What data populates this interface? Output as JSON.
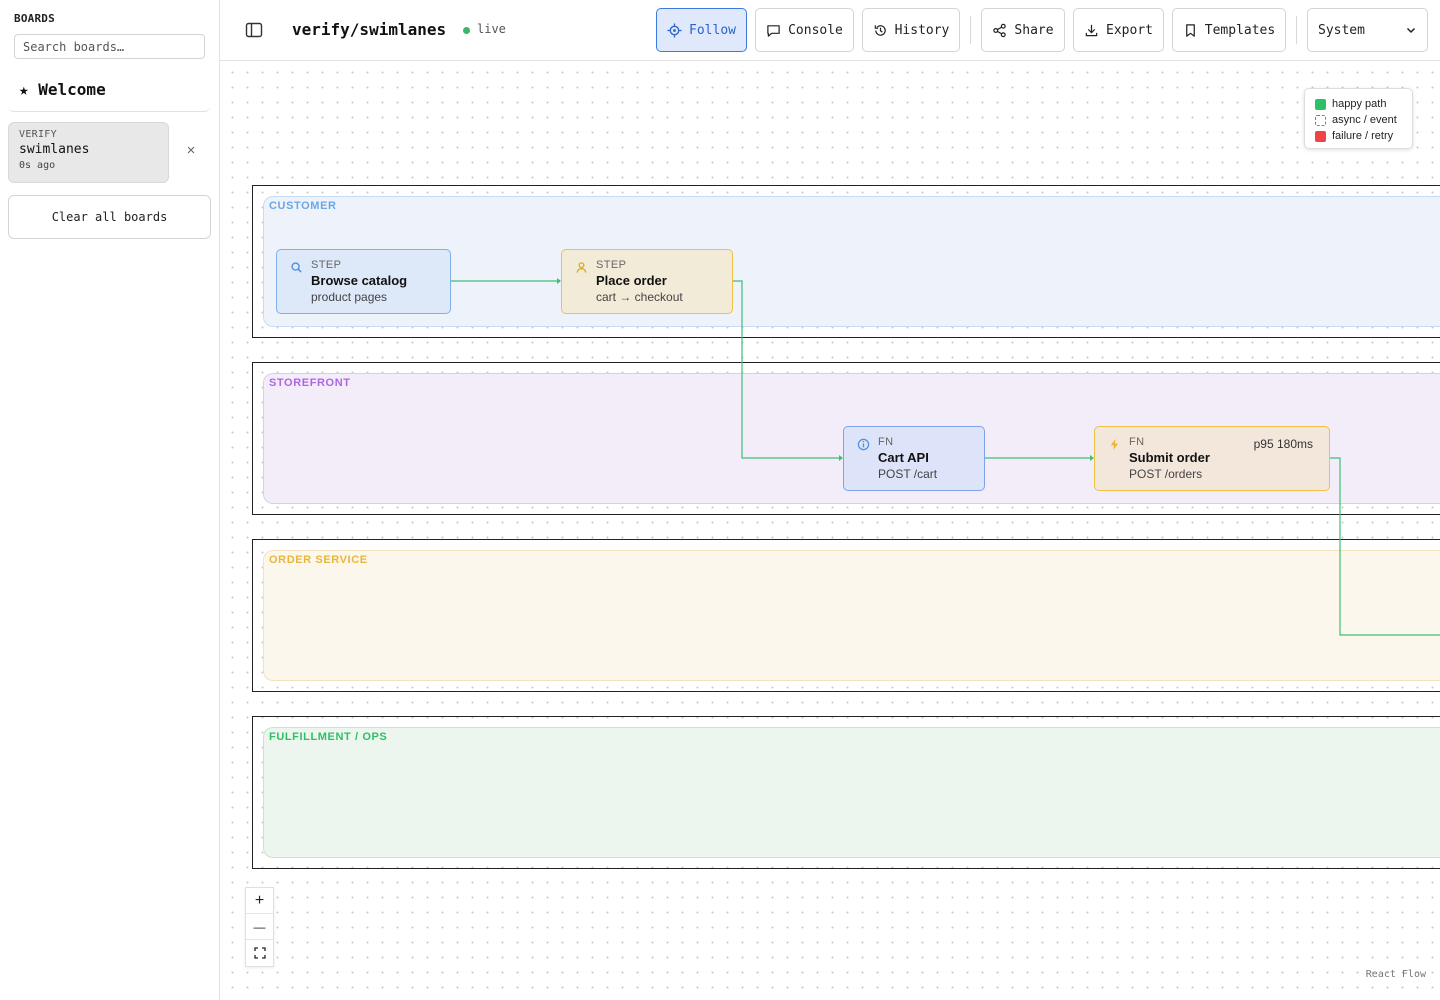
{
  "sidebar": {
    "title": "BOARDS",
    "search_placeholder": "Search boards…",
    "welcome_label": "★ Welcome",
    "active_board": {
      "group": "VERIFY",
      "name": "swimlanes",
      "time": "0s ago"
    },
    "close_glyph": "×",
    "clear_label": "Clear all boards"
  },
  "header": {
    "title": "verify/swimlanes",
    "status": "live",
    "status_color": "#3bb56c",
    "buttons": {
      "follow": "Follow",
      "console": "Console",
      "history": "History",
      "share": "Share",
      "export": "Export",
      "templates": "Templates"
    },
    "theme_value": "System"
  },
  "legend": {
    "items": [
      {
        "label": "happy path",
        "color": "#2fbf64",
        "style": "solid"
      },
      {
        "label": "async / event",
        "color": "#a855f7",
        "style": "dashed"
      },
      {
        "label": "failure / retry",
        "color": "#ef4444",
        "style": "solid"
      }
    ]
  },
  "lanes": [
    {
      "label": "CUSTOMER",
      "color": "#6aa6e8",
      "fill": "#eef3fb",
      "border": "#c5dbf5"
    },
    {
      "label": "STOREFRONT",
      "color": "#b066e0",
      "fill": "#f2edf9",
      "border": "#dccbf0"
    },
    {
      "label": "ORDER SERVICE",
      "color": "#e9b63a",
      "fill": "#fcf7ec",
      "border": "#f3e3b8"
    },
    {
      "label": "FULFILLMENT / OPS",
      "color": "#2fbf64",
      "fill": "#ecf6ef",
      "border": "#c3e6cf"
    }
  ],
  "nodes": {
    "browse": {
      "type": "STEP",
      "title": "Browse catalog",
      "subtitle": "product pages",
      "icon": "search-icon"
    },
    "place": {
      "type": "STEP",
      "title": "Place order",
      "subtitle": "cart → checkout",
      "icon": "user-icon"
    },
    "cart": {
      "type": "FN",
      "title": "Cart API",
      "subtitle": "POST /cart",
      "icon": "info-icon"
    },
    "submit": {
      "type": "FN",
      "title": "Submit order",
      "subtitle": "POST /orders",
      "metric": "p95 180ms",
      "icon": "bolt-icon"
    }
  },
  "controls": {
    "zoom_in": "+",
    "zoom_out": "—"
  },
  "attribution": "React Flow"
}
